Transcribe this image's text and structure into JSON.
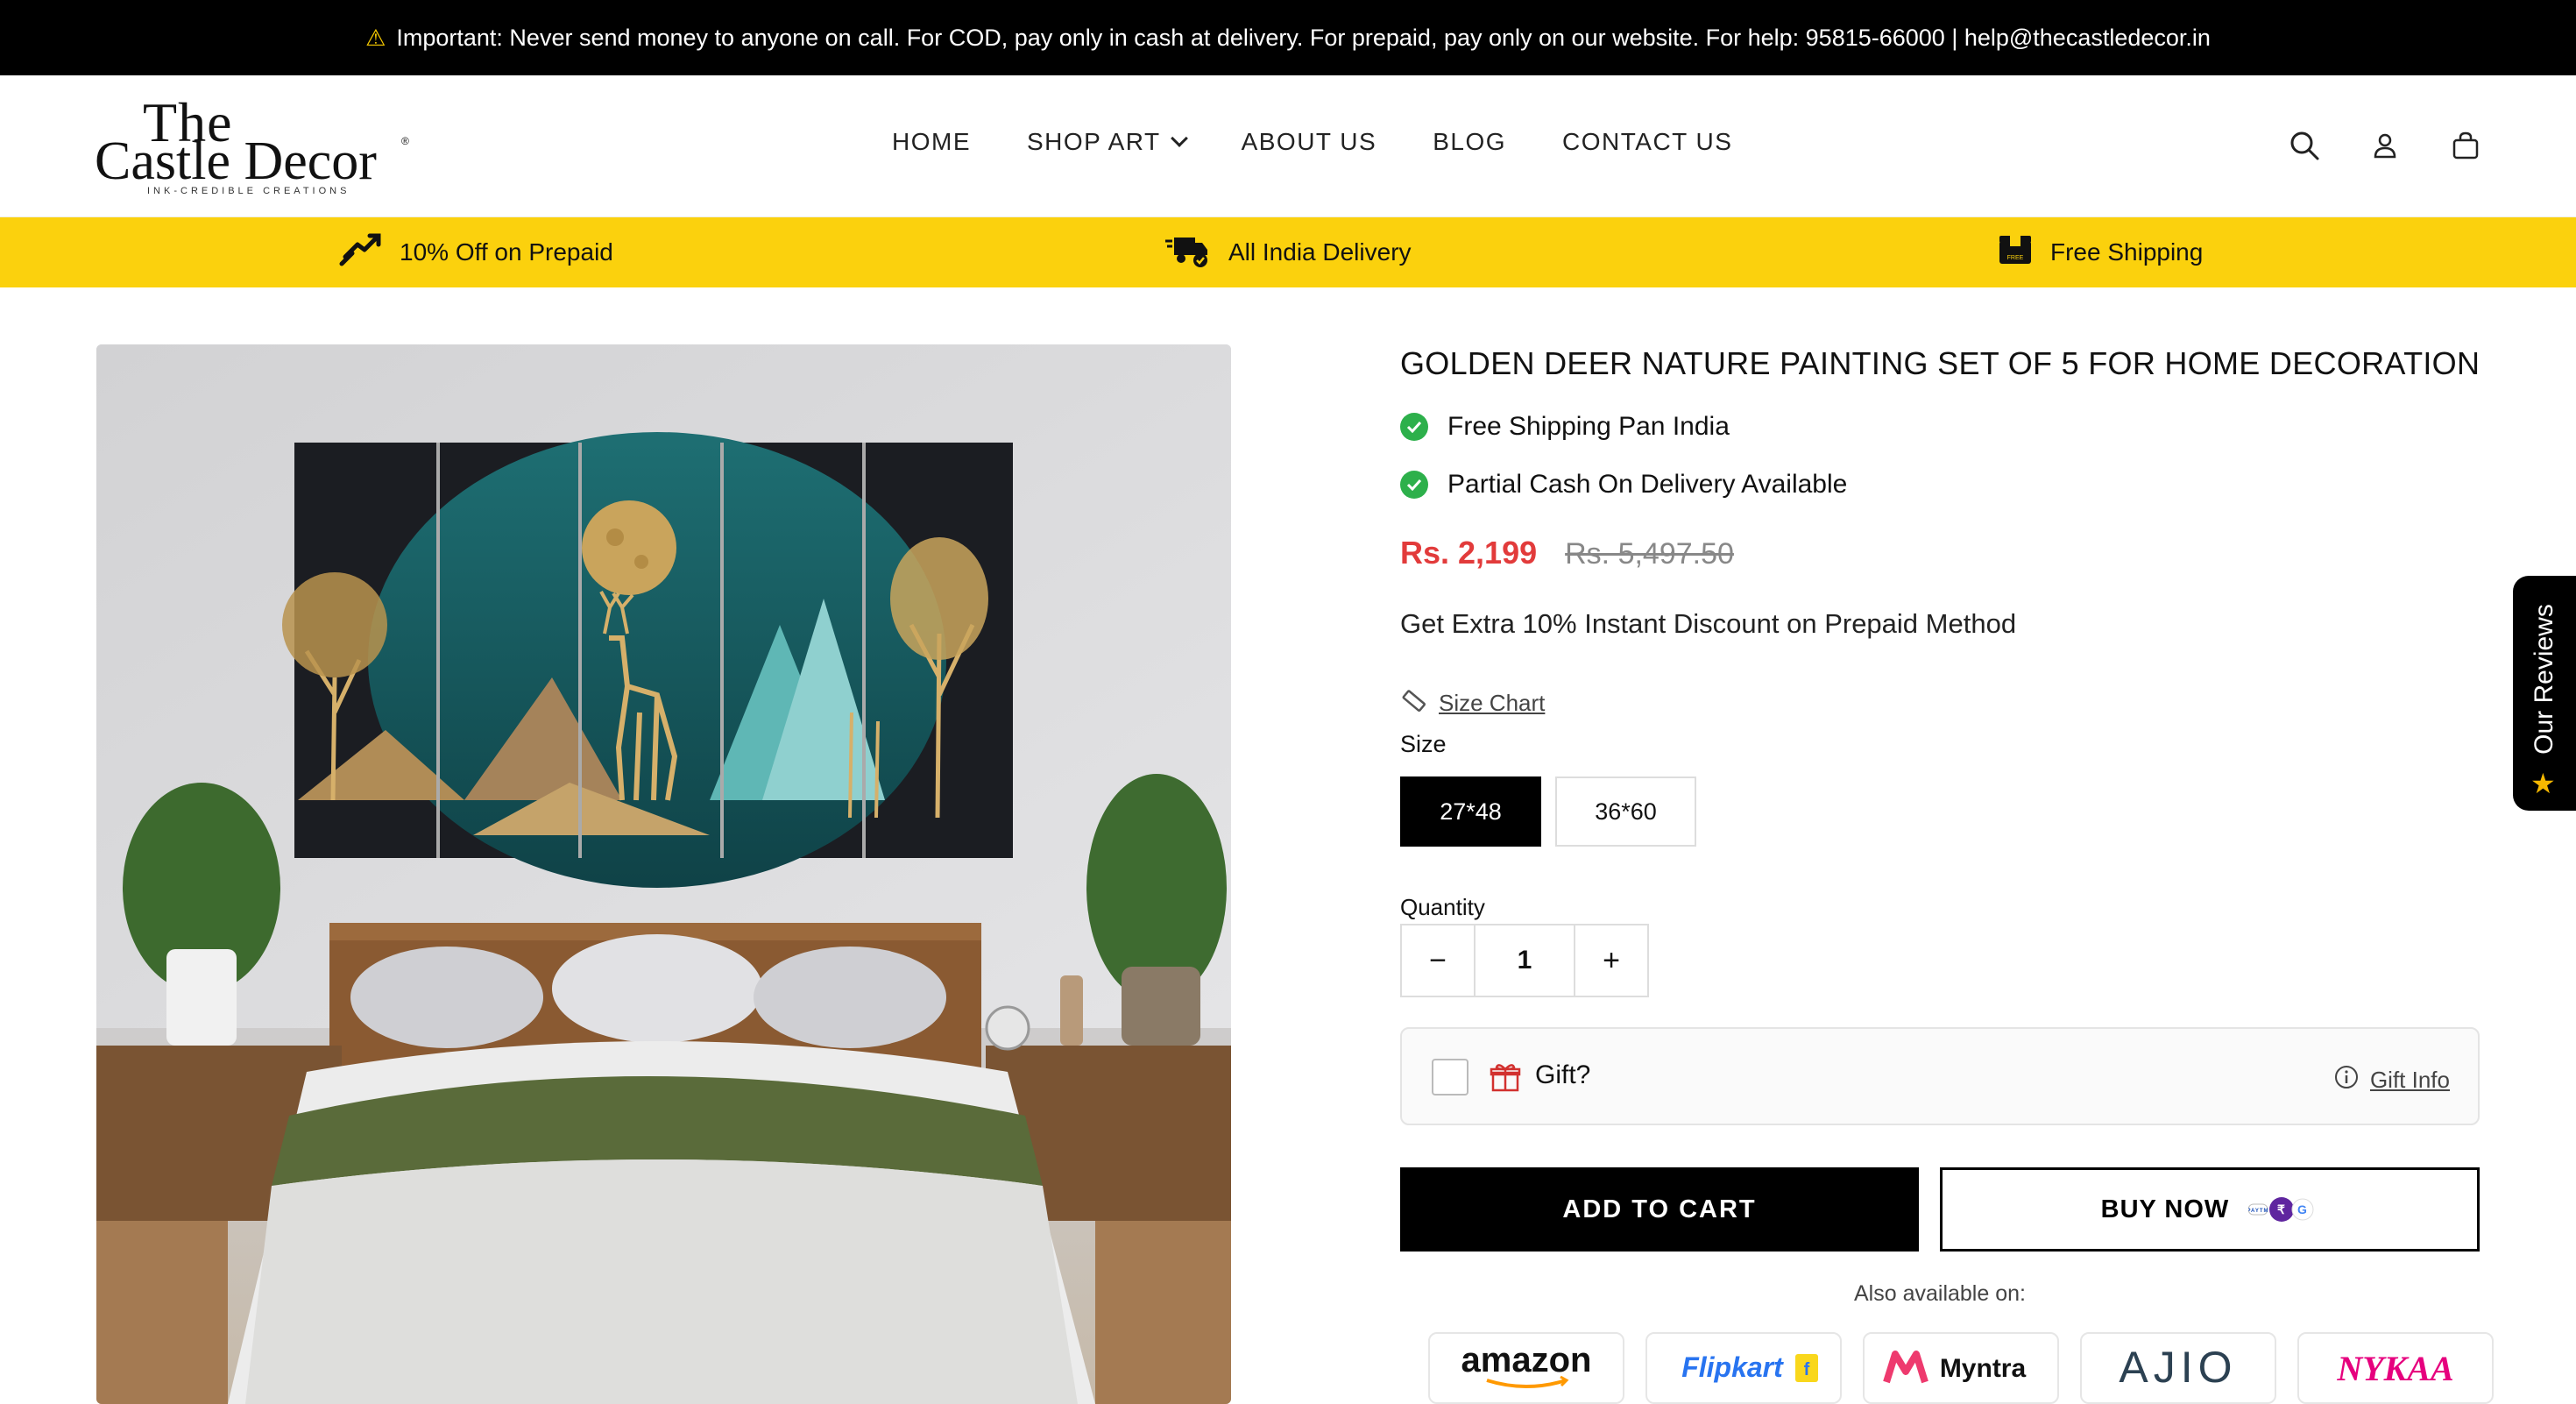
{
  "announcement": {
    "icon": "warning-icon",
    "text": "Important: Never send money to anyone on call. For COD, pay only in cash at delivery. For prepaid, pay only on our website. For help: 95815-66000 | help@thecastledecor.in"
  },
  "header": {
    "logo": {
      "line1": "The",
      "line2": "Castle Decor",
      "tagline": "INK-CREDIBLE CREATIONS",
      "reg": "®"
    },
    "nav": [
      "HOME",
      "SHOP ART",
      "ABOUT US",
      "BLOG",
      "CONTACT US"
    ],
    "icons": [
      "search-icon",
      "account-icon",
      "cart-icon"
    ]
  },
  "features": [
    {
      "icon": "discount-icon",
      "label": "10% Off on Prepaid"
    },
    {
      "icon": "delivery-truck-icon",
      "label": "All India Delivery"
    },
    {
      "icon": "free-shipping-icon",
      "label": "Free Shipping"
    }
  ],
  "product": {
    "title": "GOLDEN DEER NATURE PAINTING SET OF 5 FOR HOME DECORATION",
    "checks": [
      "Free Shipping Pan India",
      "Partial Cash On Delivery Available"
    ],
    "price": "Rs. 2,199",
    "compare_price": "Rs. 5,497.50",
    "extra_offer": "Get Extra 10% Instant Discount on Prepaid Method",
    "size_chart_label": "Size Chart",
    "size_label": "Size",
    "sizes": [
      "27*48",
      "36*60"
    ],
    "selected_size": "27*48",
    "quantity_label": "Quantity",
    "quantity": "1",
    "minus": "−",
    "plus": "+",
    "gift_label": "Gift?",
    "gift_info_label": "Gift Info",
    "add_to_cart": "ADD TO CART",
    "buy_now": "BUY NOW",
    "also_available": "Also available on:",
    "marketplaces": [
      "amazon",
      "Flipkart",
      "Myntra",
      "AJIO",
      "NYKAA"
    ]
  },
  "reviews_tab": {
    "label": "Our Reviews",
    "icon": "star-icon"
  },
  "colors": {
    "accent_yellow": "#fbd10d",
    "price_red": "#e23b3b",
    "check_green": "#2db04b",
    "black": "#000000"
  }
}
